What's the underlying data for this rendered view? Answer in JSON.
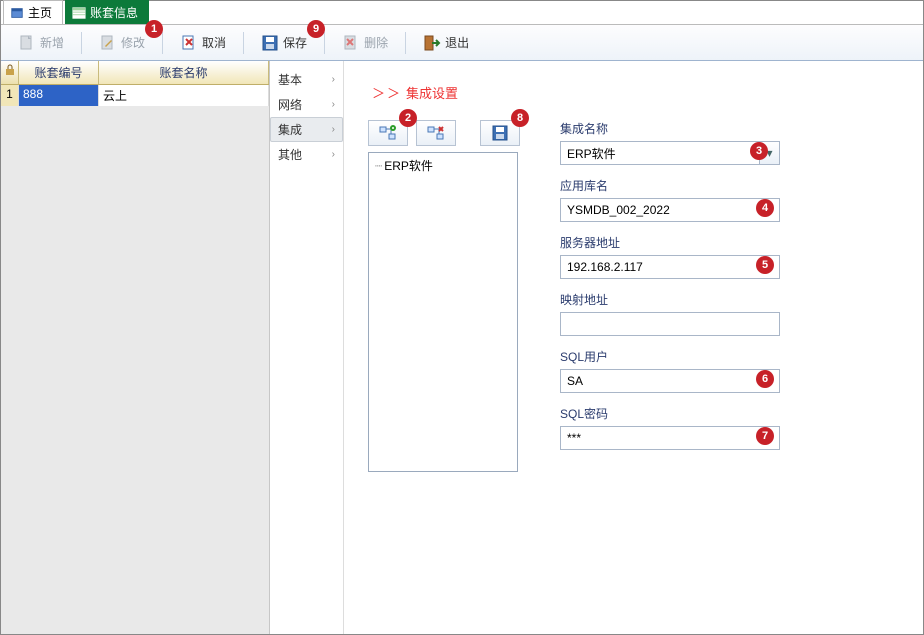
{
  "tabs": [
    {
      "label": "主页"
    },
    {
      "label": "账套信息"
    }
  ],
  "toolbar": {
    "new": "新增",
    "edit": "修改",
    "cancel": "取消",
    "save": "保存",
    "delete": "删除",
    "exit": "退出"
  },
  "grid": {
    "headers": {
      "num": "账套编号",
      "name": "账套名称"
    },
    "rows": [
      {
        "idx": "1",
        "num": "888",
        "name": "云上"
      }
    ]
  },
  "sidenav": [
    {
      "label": "基本"
    },
    {
      "label": "网络"
    },
    {
      "label": "集成"
    },
    {
      "label": "其他"
    }
  ],
  "crumb": {
    "arrows": "＞＞",
    "title": "集成设置"
  },
  "tree": {
    "items": [
      "ERP软件"
    ]
  },
  "form": {
    "integration_name": {
      "label": "集成名称",
      "value": "ERP软件"
    },
    "app_db": {
      "label": "应用库名",
      "value": "YSMDB_002_2022"
    },
    "server_addr": {
      "label": "服务器地址",
      "value": "192.168.2.117"
    },
    "map_addr": {
      "label": "映射地址",
      "value": ""
    },
    "sql_user": {
      "label": "SQL用户",
      "value": "SA"
    },
    "sql_pwd": {
      "label": "SQL密码",
      "value": "***"
    }
  },
  "badges": [
    "1",
    "2",
    "3",
    "4",
    "5",
    "6",
    "7",
    "8",
    "9"
  ]
}
